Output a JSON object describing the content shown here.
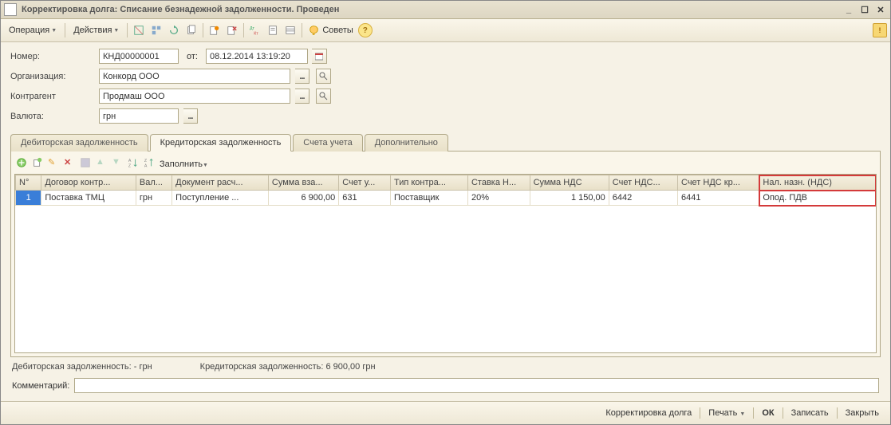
{
  "window": {
    "title": "Корректировка долга: Списание безнадежной задолженности. Проведен"
  },
  "menus": {
    "operation": "Операция",
    "actions": "Действия",
    "advice": "Советы"
  },
  "form": {
    "number_label": "Номер:",
    "number_value": "КНД00000001",
    "from_label": "от:",
    "date_value": "08.12.2014 13:19:20",
    "org_label": "Организация:",
    "org_value": "Конкорд ООО",
    "counterparty_label": "Контрагент",
    "counterparty_value": "Продмаш ООО",
    "currency_label": "Валюта:",
    "currency_value": "грн"
  },
  "tabs": {
    "t0": "Дебиторская задолженность",
    "t1": "Кредиторская задолженность",
    "t2": "Счета учета",
    "t3": "Дополнительно"
  },
  "tabletoolbar": {
    "fill": "Заполнить"
  },
  "grid": {
    "headers": {
      "n": "N°",
      "contract": "Договор контр...",
      "currency": "Вал...",
      "doc": "Документ расч...",
      "sum": "Сумма вза...",
      "acct": "Счет у...",
      "type": "Тип контра...",
      "rate": "Ставка Н...",
      "vat": "Сумма НДС",
      "vatacct1": "Счет  НДС...",
      "vatacct2": "Счет  НДС кр...",
      "taxdest": "Нал. назн. (НДС)"
    },
    "row": {
      "n": "1",
      "contract": "Поставка ТМЦ",
      "currency": "грн",
      "doc": "Поступление ...",
      "sum": "6 900,00",
      "acct": "631",
      "type": "Поставщик",
      "rate": "20%",
      "vat": "1 150,00",
      "vatacct1": "6442",
      "vatacct2": "6441",
      "taxdest": "Опод. ПДВ"
    }
  },
  "totals": {
    "debit": "Дебиторская задолженность: - грн",
    "credit": "Кредиторская задолженность: 6 900,00 грн"
  },
  "comment_label": "Комментарий:",
  "comment_value": "",
  "bottom": {
    "docname": "Корректировка долга",
    "print": "Печать",
    "ok": "ОК",
    "save": "Записать",
    "close": "Закрыть"
  }
}
